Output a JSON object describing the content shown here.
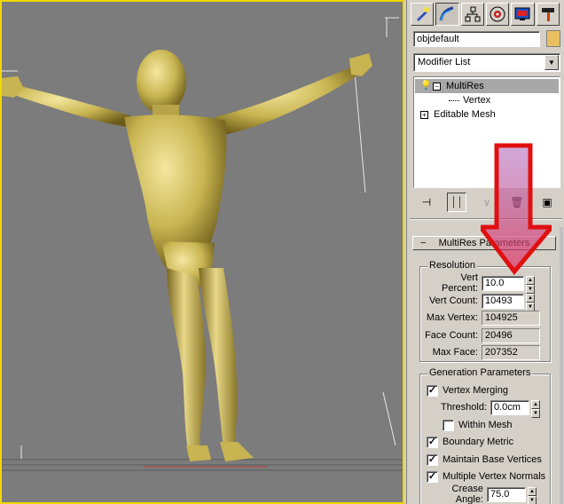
{
  "panel": {
    "object_name": "objdefault",
    "object_color": "#e8c060",
    "modifier_list": "Modifier List",
    "stack": [
      {
        "label": "MultiRes",
        "selected": true
      },
      {
        "label": "Vertex",
        "sub": true
      },
      {
        "label": "Editable Mesh"
      }
    ]
  },
  "rollout": {
    "title": "MultiRes Parameters",
    "resolution": {
      "title": "Resolution",
      "vert_percent_label": "Vert Percent:",
      "vert_percent": "10.0",
      "vert_count_label": "Vert Count:",
      "vert_count": "10493",
      "max_vertex_label": "Max Vertex:",
      "max_vertex": "104925",
      "face_count_label": "Face Count:",
      "face_count": "20496",
      "max_face_label": "Max Face:",
      "max_face": "207352"
    },
    "generation": {
      "title": "Generation Parameters",
      "vertex_merging": "Vertex Merging",
      "threshold_label": "Threshold:",
      "threshold": "0.0cm",
      "within_mesh": "Within Mesh",
      "boundary_metric": "Boundary Metric",
      "maintain_base": "Maintain Base Vertices",
      "multiple_normals": "Multiple Vertex Normals",
      "crease_angle_label": "Crease Angle:",
      "crease_angle": "75.0"
    }
  },
  "colors": {
    "viewport_bg": "#7c7c7c",
    "viewport_border": "#f0d800",
    "figure": "#d8c870",
    "arrow": "#e01010"
  }
}
